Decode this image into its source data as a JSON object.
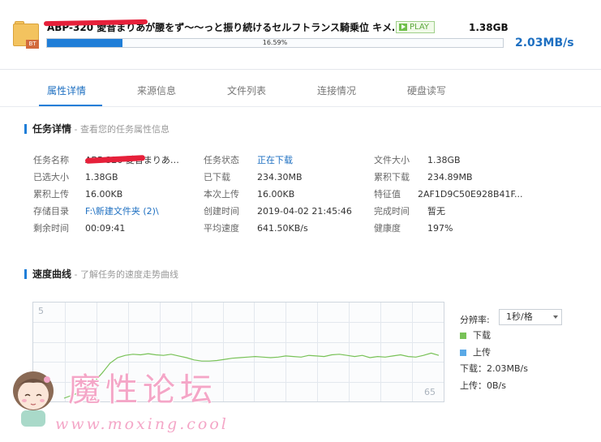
{
  "download": {
    "name": "ABP-320 愛音まりあが腰をず～～っと振り続けるセルフトランス騎乗位 キメ…",
    "file_type_badge": "BT",
    "play_label": "PLAY",
    "size": "1.38GB",
    "progress_text": "16.59%",
    "progress_fraction": 0.1659,
    "speed": "2.03MB/s"
  },
  "tabs": [
    {
      "label": "属性详情",
      "active": true
    },
    {
      "label": "来源信息",
      "active": false
    },
    {
      "label": "文件列表",
      "active": false
    },
    {
      "label": "连接情况",
      "active": false
    },
    {
      "label": "硬盘读写",
      "active": false
    }
  ],
  "task_section": {
    "title": "任务详情",
    "subtitle": " - 查看您的任务属性信息"
  },
  "details": {
    "task_name_label": "任务名称",
    "task_name_value": "ABP-320 愛音まりあ…",
    "status_label": "任务状态",
    "status_value": "正在下载",
    "file_size_label": "文件大小",
    "file_size_value": "1.38GB",
    "selected_size_label": "已选大小",
    "selected_size_value": "1.38GB",
    "downloaded_label": "已下载",
    "downloaded_value": "234.30MB",
    "total_downloaded_label": "累积下载",
    "total_downloaded_value": "234.89MB",
    "total_uploaded_label": "累积上传",
    "total_uploaded_value": "16.00KB",
    "session_uploaded_label": "本次上传",
    "session_uploaded_value": "16.00KB",
    "hash_label": "特征值",
    "hash_value": "2AF1D9C50E928B41F...",
    "save_dir_label": "存储目录",
    "save_dir_value": "F:\\新建文件夹 (2)\\",
    "created_label": "创建时间",
    "created_value": "2019-04-02 21:45:46",
    "completed_label": "完成时间",
    "completed_value": "暂无",
    "remaining_label": "剩余时间",
    "remaining_value": "00:09:41",
    "avg_speed_label": "平均速度",
    "avg_speed_value": "641.50KB/s",
    "health_label": "健康度",
    "health_value": "197%"
  },
  "speed_section": {
    "title": "速度曲线",
    "subtitle": " - 了解任务的速度走势曲线"
  },
  "chart_data": {
    "type": "line",
    "y_top_label": "5",
    "x_right_label": "65",
    "series": [
      {
        "name": "下载",
        "color": "#78c257",
        "values": [
          0,
          0.05,
          0.1,
          0.18,
          0.3,
          0.45,
          0.62,
          0.72,
          0.76,
          0.78,
          0.77,
          0.79,
          0.77,
          0.76,
          0.78,
          0.75,
          0.72,
          0.68,
          0.66,
          0.66,
          0.67,
          0.69,
          0.71,
          0.72,
          0.73,
          0.74,
          0.73,
          0.72,
          0.73,
          0.75,
          0.74,
          0.73,
          0.76,
          0.75,
          0.74,
          0.77,
          0.78,
          0.76,
          0.74,
          0.76,
          0.72,
          0.74,
          0.73,
          0.75,
          0.77,
          0.74,
          0.73,
          0.76,
          0.8,
          0.76
        ]
      },
      {
        "name": "上传",
        "color": "#5aa9e6",
        "values": []
      }
    ],
    "grid": true
  },
  "legend": {
    "resolution_label": "分辨率:",
    "resolution_value": "1秒/格",
    "download_label": "下载",
    "upload_label": "上传",
    "download_stat": "下载：2.03MB/s",
    "upload_stat": "上传：0B/s"
  },
  "watermark": {
    "title": "魔性论坛",
    "url": "www.moxing.cool"
  }
}
